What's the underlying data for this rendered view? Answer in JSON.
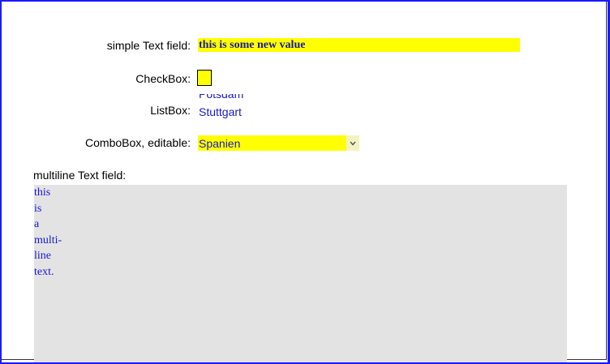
{
  "form": {
    "simple_text": {
      "label": "simple Text field:",
      "value": "this is some new value"
    },
    "checkbox": {
      "label": "CheckBox:",
      "checked": false
    },
    "listbox": {
      "label": "ListBox:",
      "visible_items": [
        "Potsdam",
        "Stuttgart"
      ],
      "selected": "Stuttgart"
    },
    "combobox": {
      "label": "ComboBox, editable:",
      "value": "Spanien",
      "icon": "chevron-down-icon"
    },
    "multiline": {
      "label": "multiline Text field:",
      "value": "this\nis\na\nmulti-\nline\ntext."
    }
  },
  "colors": {
    "field_fill": "#ffff00",
    "field_text": "#1a1acc",
    "textarea_fill": "#e3e3e3",
    "page_border": "#1a1aff"
  }
}
